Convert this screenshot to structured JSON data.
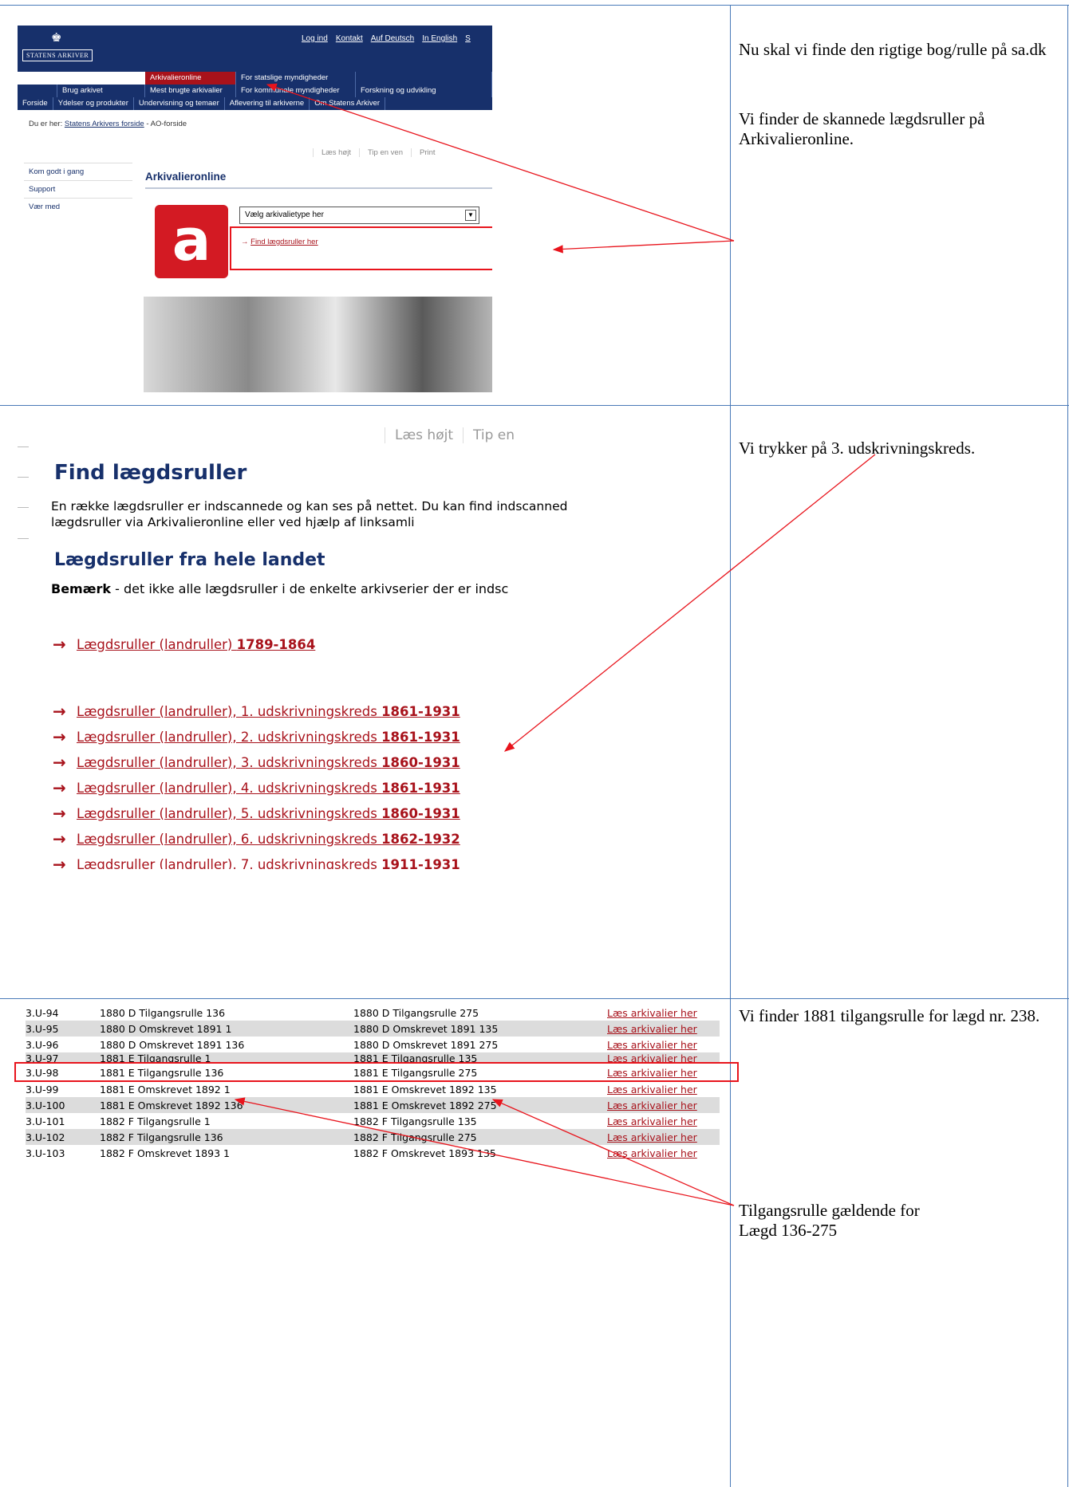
{
  "notes": {
    "panel1": [
      "Nu skal vi finde den rigtige bog/rulle på sa.dk",
      "Vi finder de skannede lægdsruller på Arkivalieronline."
    ],
    "panel2": "Vi trykker på 3. udskrivningskreds.",
    "panel3_top": "Vi finder 1881 tilgangsrulle for lægd nr. 238.",
    "panel3_bottom": [
      "Tilgangsrulle gældende for",
      "Lægd 136-275"
    ]
  },
  "site": {
    "logo_text": "STATENS ARKIVER",
    "top_links": [
      "Log ind",
      "Kontakt",
      "Auf Deutsch",
      "In English",
      "S"
    ],
    "nav_row1": [
      "Arkivalieronline",
      "For statslige myndigheder"
    ],
    "nav_row2": [
      "Brug arkivet",
      "Mest brugte arkivalier",
      "For kommunale myndigheder",
      "Forskning og udvikling"
    ],
    "nav_row3": [
      "Forside",
      "Ydelser og produkter",
      "Undervisning og temaer",
      "Aflevering til arkiverne",
      "Om Statens Arkiver"
    ],
    "breadcrumb_prefix": "Du er her:",
    "breadcrumb_link": "Statens Arkivers forside",
    "breadcrumb_current": "- AO-forside",
    "toolbar": [
      "Læs højt",
      "Tip en ven",
      "Print"
    ],
    "sidenav": [
      "Kom godt i gang",
      "Support",
      "Vær med"
    ],
    "heading": "Arkivalieronline",
    "select_value": "Vælg arkivalietype her",
    "find_link": "Find lægdsruller her"
  },
  "find": {
    "toolbar": [
      "Læs højt",
      "Tip en"
    ],
    "title": "Find lægdsruller",
    "intro": "En række lægdsruller er indscannede og kan ses på nettet. Du kan find indscannede lægdsruller via Arkivalieronline eller ved hjælp af linksamli",
    "subtitle": "Lægdsruller fra hele landet",
    "remark_bold": "Bemærk",
    "remark_text": " - det ikke alle lægdsruller i de enkelte arkivserier der er indsc",
    "first_link": {
      "text": "Lægdsruller (landruller) ",
      "years": "1789-1864"
    },
    "links": [
      {
        "text": "Lægdsruller (landruller), 1. udskrivningskreds ",
        "years": "1861-1931"
      },
      {
        "text": "Lægdsruller (landruller), 2. udskrivningskreds ",
        "years": "1861-1931"
      },
      {
        "text": "Lægdsruller (landruller), 3. udskrivningskreds ",
        "years": "1860-1931"
      },
      {
        "text": "Lægdsruller (landruller), 4. udskrivningskreds ",
        "years": "1861-1931"
      },
      {
        "text": "Lægdsruller (landruller), 5. udskrivningskreds ",
        "years": "1860-1931"
      },
      {
        "text": "Lægdsruller (landruller), 6. udskrivningskreds ",
        "years": "1862-1932"
      },
      {
        "text": "Lægdsruller (landruller), 7. udskrivningskreds ",
        "years": "1911-1931"
      }
    ]
  },
  "table": {
    "rows": [
      [
        "3.U-94",
        "1880 D Tilgangsrulle 136",
        "1880 D Tilgangsrulle 275",
        "Læs arkivalier her"
      ],
      [
        "3.U-95",
        "1880 D Omskrevet 1891 1",
        "1880 D Omskrevet 1891 135",
        "Læs arkivalier her"
      ],
      [
        "3.U-96",
        "1880 D Omskrevet 1891 136",
        "1880 D Omskrevet 1891 275",
        "Læs arkivalier her"
      ],
      [
        "3.U-97",
        "1881 E Tilgangsrulle 1",
        "1881 E Tilgangsrulle 135",
        "Læs arkivalier her"
      ],
      [
        "3.U-98",
        "1881 E Tilgangsrulle 136",
        "1881 E Tilgangsrulle 275",
        "Læs arkivalier her"
      ],
      [
        "3.U-99",
        "1881 E Omskrevet 1892 1",
        "1881 E Omskrevet 1892 135",
        "Læs arkivalier her"
      ],
      [
        "3.U-100",
        "1881 E Omskrevet 1892 136",
        "1881 E Omskrevet 1892 275",
        "Læs arkivalier her"
      ],
      [
        "3.U-101",
        "1882 F Tilgangsrulle 1",
        "1882 F Tilgangsrulle 135",
        "Læs arkivalier her"
      ],
      [
        "3.U-102",
        "1882 F Tilgangsrulle 136",
        "1882 F Tilgangsrulle 275",
        "Læs arkivalier her"
      ],
      [
        "3.U-103",
        "1882 F Omskrevet 1893 1",
        "1882 F Omskrevet 1893 135",
        "Læs arkivalier her"
      ]
    ]
  },
  "colors": {
    "grid": "#4a7ab8",
    "annotation": "#e8141c",
    "link": "#a8121b",
    "navy": "#17306b"
  }
}
